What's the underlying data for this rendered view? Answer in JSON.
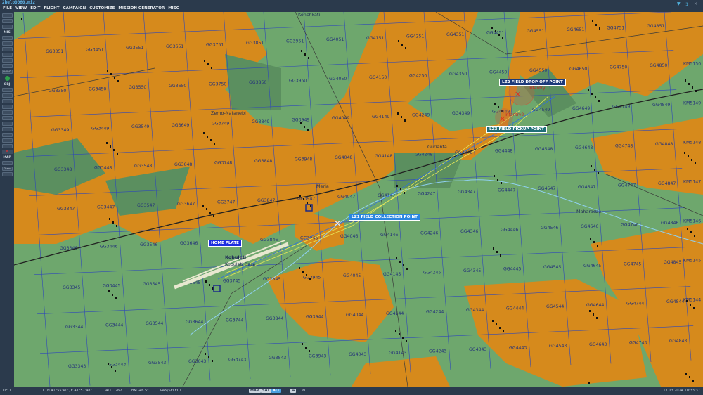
{
  "window": {
    "title": "2helo0060.miz",
    "icons": [
      "wifi-icon",
      "pin-icon",
      "close-icon"
    ]
  },
  "menu": [
    "FILE",
    "VIEW",
    "EDIT",
    "FLIGHT",
    "CAMPAIGN",
    "CUSTOMIZE",
    "MISSION GENERATOR",
    "MISC"
  ],
  "toolbar": {
    "sections": {
      "mis": "MIS",
      "obj": "OBJ",
      "map": "MAP"
    },
    "map_buttons": [
      "Draw"
    ],
    "mis_text": "0H0H2"
  },
  "map": {
    "colors": {
      "land": "#6ea76d",
      "forest": "#d68a1c",
      "dark_land": "#5b8f5f",
      "grid": "#2f48b8",
      "road": "#2b2b2b"
    },
    "grid_labels": [
      "GG3351",
      "GG3451",
      "GG3551",
      "GG3651",
      "GG3751",
      "GG3851",
      "GG3951",
      "GG4051",
      "GG4151",
      "GG4251",
      "GG4351",
      "GG4451",
      "GG4551",
      "GG4651",
      "GG4751",
      "GG4851",
      "GG3350",
      "GG3450",
      "GG3550",
      "GG3650",
      "GG3750",
      "GG3850",
      "GG3950",
      "GG4050",
      "GG4150",
      "GG4250",
      "GG4350",
      "GG4450",
      "GG4550",
      "GG4650",
      "GG4750",
      "GG4850",
      "GG3349",
      "GG3449",
      "GG3549",
      "GG3649",
      "GG3749",
      "GG3849",
      "GG3949",
      "GG4049",
      "GG4149",
      "GG4249",
      "GG4349",
      "GG4449",
      "GG4549",
      "GG4649",
      "GG4749",
      "GG4849",
      "GG3348",
      "GG3448",
      "GG3548",
      "GG3648",
      "GG3748",
      "GG3848",
      "GG3948",
      "GG4048",
      "GG4148",
      "GG4248",
      "GG4348",
      "GG4448",
      "GG4548",
      "GG4648",
      "GG4748",
      "GG4848",
      "GG3347",
      "GG3447",
      "GG3547",
      "GG3647",
      "GG3747",
      "GG3847",
      "GG3947",
      "GG4047",
      "GG4147",
      "GG4247",
      "GG4347",
      "GG4447",
      "GG4547",
      "GG4647",
      "GG4747",
      "GG4847",
      "GG3346",
      "GG3446",
      "GG3546",
      "GG3646",
      "GG3746",
      "GG3846",
      "GG3946",
      "GG4046",
      "GG4146",
      "GG4246",
      "GG4346",
      "GG4446",
      "GG4546",
      "GG4646",
      "GG4746",
      "GG4846",
      "GG3345",
      "GG3445",
      "GG3545",
      "GG3645",
      "GG3745",
      "GG3845",
      "GG3945",
      "GG4045",
      "GG4145",
      "GG4245",
      "GG4345",
      "GG4445",
      "GG4545",
      "GG4645",
      "GG4745",
      "GG4845",
      "GG3344",
      "GG3444",
      "GG3544",
      "GG3644",
      "GG3744",
      "GG3844",
      "GG3944",
      "GG4044",
      "GG4144",
      "GG4244",
      "GG4344",
      "GG4444",
      "GG4544",
      "GG4644",
      "GG4744",
      "GG4844",
      "GG3343",
      "GG3443",
      "GG3543",
      "GG3643",
      "GG3743",
      "GG3843",
      "GG3943",
      "GG4043",
      "GG4143",
      "GG4243",
      "GG4343",
      "GG4443",
      "GG4543",
      "GG4643",
      "GG4743",
      "GG4843",
      "KM5150",
      "KM5149",
      "KM5148",
      "KM5147",
      "KM5146",
      "KM5145",
      "KM5144"
    ],
    "places": [
      "Zemo-Natanebi",
      "Meria",
      "Gurianta",
      "Maharadze",
      "Kobuleti",
      "Konchkati",
      "Kobuleti Base"
    ],
    "units": [
      "Infantry",
      "Infantry2"
    ],
    "waypoint_labels": {
      "lz2": "LZ2 FIELD DROP OFF POINT",
      "lz3": "LZ3 FIELD PICKUP POINT",
      "lz1": "LZ1 FIELD COLLECTION POINT",
      "home": "HOME PLATE"
    }
  },
  "status": {
    "mode": "DFLT",
    "coords_label": "LL",
    "coords": "N 41°55'41\", E 41°57'48\"",
    "alt_label": "ALT",
    "alt": "262",
    "bm_label": "BM",
    "bm": "+6.5°",
    "tool": "PAN/SELECT",
    "views": [
      "MAP",
      "SAT",
      "ALT"
    ],
    "active_view": "ALT",
    "datetime": "17.03.2024 10:33:37"
  }
}
